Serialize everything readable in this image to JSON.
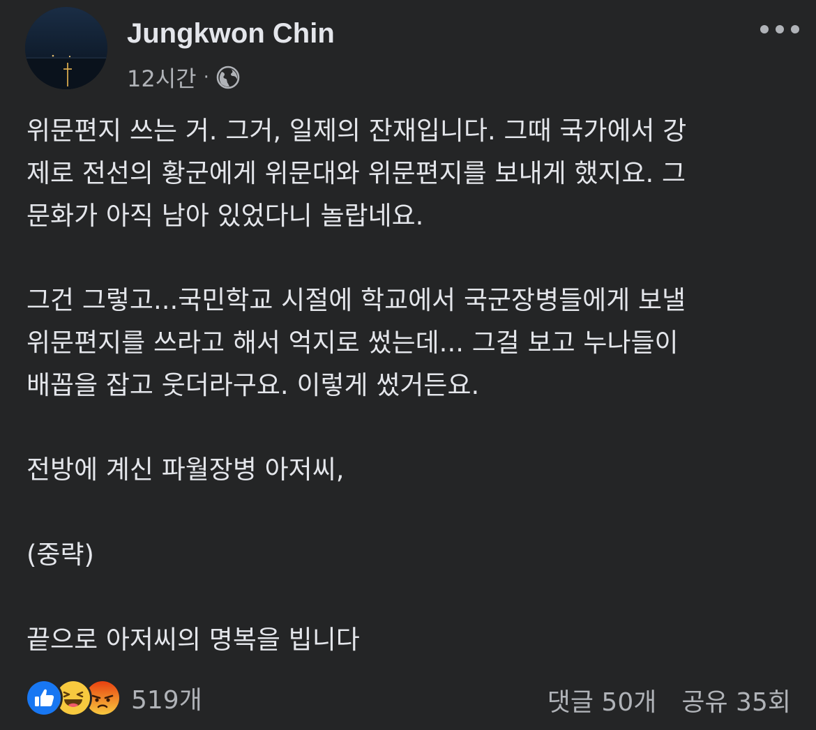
{
  "header": {
    "author": "Jungkwon Chin",
    "time": "12시간",
    "separator": "·",
    "privacy_icon": "globe-icon",
    "more_icon": "more-options-icon"
  },
  "post": {
    "lines": [
      "위문편지 쓰는 거. 그거, 일제의 잔재입니다. 그때 국가에서 강",
      "제로 전선의 황군에게 위문대와 위문편지를 보내게 했지요. 그",
      "문화가 아직 남아 있었다니 놀랍네요.",
      "",
      "그건 그렇고...국민학교 시절에 학교에서 국군장병들에게 보낼",
      "위문편지를 쓰라고 해서 억지로 썼는데... 그걸 보고 누나들이",
      "배꼽을 잡고 웃더라구요. 이렇게 썼거든요.",
      "",
      "전방에 계신 파월장병 아저씨,",
      "",
      "(중략)",
      "",
      "끝으로 아저씨의 명복을 빕니다"
    ]
  },
  "footer": {
    "reaction_icons": [
      "like-icon",
      "haha-icon",
      "angry-icon"
    ],
    "reaction_count": "519개",
    "comments": "댓글 50개",
    "shares": "공유 35회"
  },
  "colors": {
    "background": "#242526",
    "text_primary": "#e4e6eb",
    "text_secondary": "#b0b3b8",
    "like_blue": "#1877f2",
    "haha_yellow": "#f7c93f",
    "angry_orange": "#e9710f"
  }
}
